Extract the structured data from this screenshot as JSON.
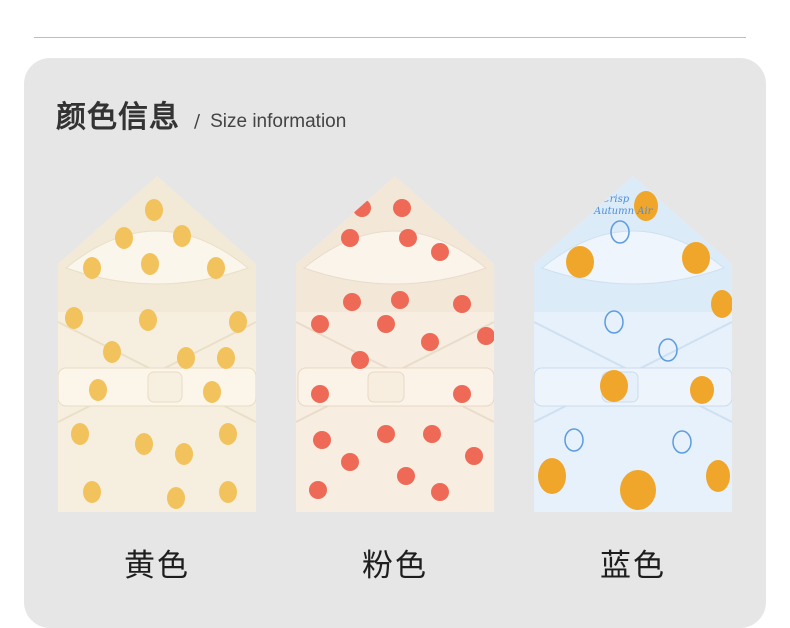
{
  "header": {
    "title_cn": "颜色信息",
    "separator": "/",
    "title_en": "Size information"
  },
  "products": [
    {
      "label": "黄色",
      "fabric": "#f6efe0",
      "motif": "yellow-pear",
      "motif_color": "#f2c35c"
    },
    {
      "label": "粉色",
      "fabric": "#f7ede1",
      "motif": "red-apple",
      "motif_color": "#ee6a56"
    },
    {
      "label": "蓝色",
      "fabric": "#e6f1fb",
      "motif": "orange-pear",
      "motif_color": "#f0a62b",
      "print_text": [
        "Crisp",
        "Autumn Air"
      ]
    }
  ]
}
